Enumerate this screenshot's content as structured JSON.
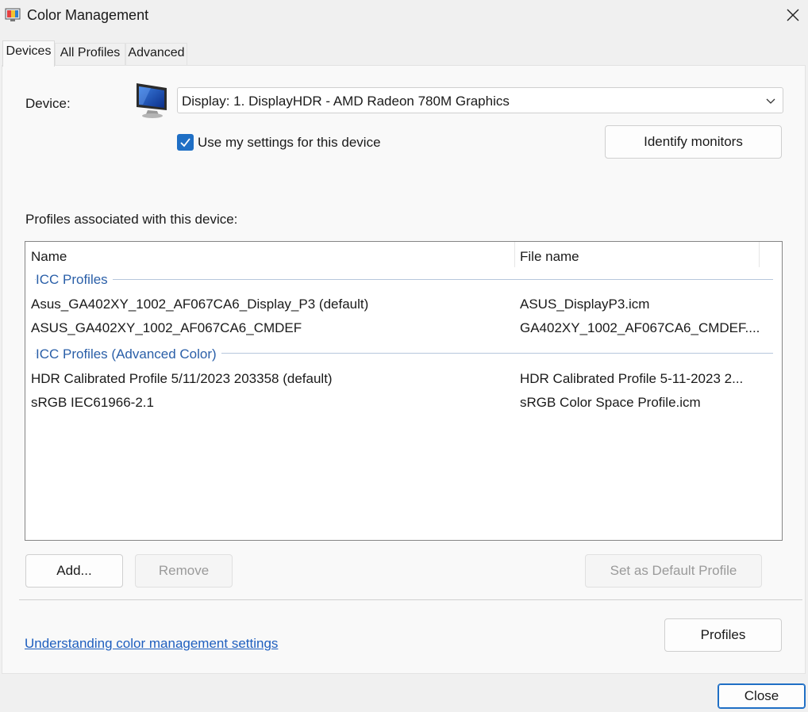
{
  "window": {
    "title": "Color Management",
    "close_icon": "close-icon",
    "app_icon": "color-management-icon"
  },
  "tabs": [
    {
      "label": "Devices",
      "active": true
    },
    {
      "label": "All Profiles",
      "active": false
    },
    {
      "label": "Advanced",
      "active": false
    }
  ],
  "device": {
    "label": "Device:",
    "icon": "monitor-icon",
    "selected": "Display: 1. DisplayHDR - AMD Radeon 780M Graphics",
    "use_settings_label": "Use my settings for this device",
    "use_settings_checked": true,
    "identify_button": "Identify monitors"
  },
  "profiles": {
    "label": "Profiles associated with this device:",
    "columns": [
      "Name",
      "File name"
    ],
    "groups": [
      {
        "title": "ICC Profiles",
        "rows": [
          {
            "name": "Asus_GA402XY_1002_AF067CA6_Display_P3 (default)",
            "file": "ASUS_DisplayP3.icm"
          },
          {
            "name": "ASUS_GA402XY_1002_AF067CA6_CMDEF",
            "file": "GA402XY_1002_AF067CA6_CMDEF...."
          }
        ]
      },
      {
        "title": "ICC Profiles (Advanced Color)",
        "rows": [
          {
            "name": "HDR Calibrated Profile 5/11/2023 203358 (default)",
            "file": "HDR Calibrated Profile 5-11-2023 2..."
          },
          {
            "name": "sRGB IEC61966-2.1",
            "file": "sRGB Color Space Profile.icm"
          }
        ]
      }
    ]
  },
  "buttons": {
    "add": "Add...",
    "remove": "Remove",
    "set_default": "Set as Default Profile",
    "profiles": "Profiles",
    "close": "Close"
  },
  "link": "Understanding color management settings",
  "colors": {
    "accent": "#1f6fc5",
    "link": "#1f5fbf",
    "group": "#2a5fa8"
  }
}
